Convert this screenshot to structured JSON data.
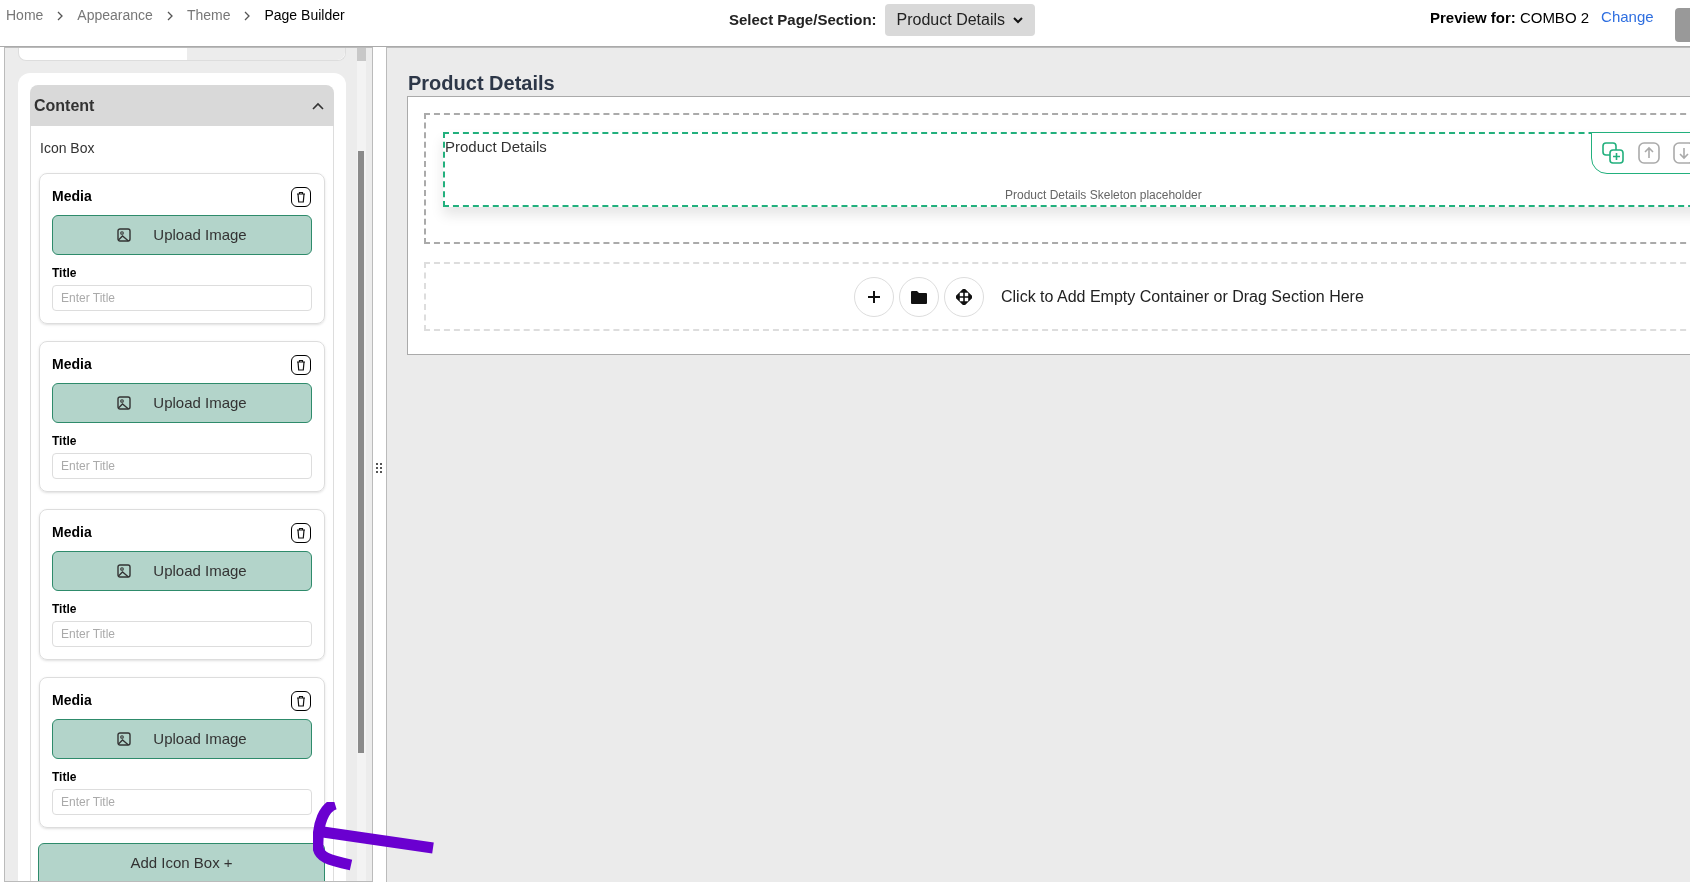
{
  "breadcrumb": [
    {
      "label": "Home",
      "current": false
    },
    {
      "label": "Appearance",
      "current": false
    },
    {
      "label": "Theme",
      "current": false
    },
    {
      "label": "Page Builder",
      "current": true
    }
  ],
  "page_select": {
    "label": "Select Page/Section:",
    "value": "Product Details"
  },
  "preview": {
    "label": "Preview for:",
    "value": "COMBO 2",
    "link": "Change"
  },
  "sidebar": {
    "section": {
      "title": "Content",
      "expanded": true
    },
    "group_label": "Icon Box",
    "items": [
      {
        "heading": "Media",
        "button": "Upload Image",
        "field_label": "Title",
        "placeholder": "Enter Title"
      },
      {
        "heading": "Media",
        "button": "Upload Image",
        "field_label": "Title",
        "placeholder": "Enter Title"
      },
      {
        "heading": "Media",
        "button": "Upload Image",
        "field_label": "Title",
        "placeholder": "Enter Title"
      },
      {
        "heading": "Media",
        "button": "Upload Image",
        "field_label": "Title",
        "placeholder": "Enter Title"
      }
    ],
    "add_button": "Add Icon Box +"
  },
  "canvas": {
    "title": "Product Details",
    "section": {
      "label": "Product Details",
      "placeholder": "Product Details Skeleton placeholder"
    },
    "add_prompt": "Click to Add Empty Container or Drag Section Here"
  }
}
